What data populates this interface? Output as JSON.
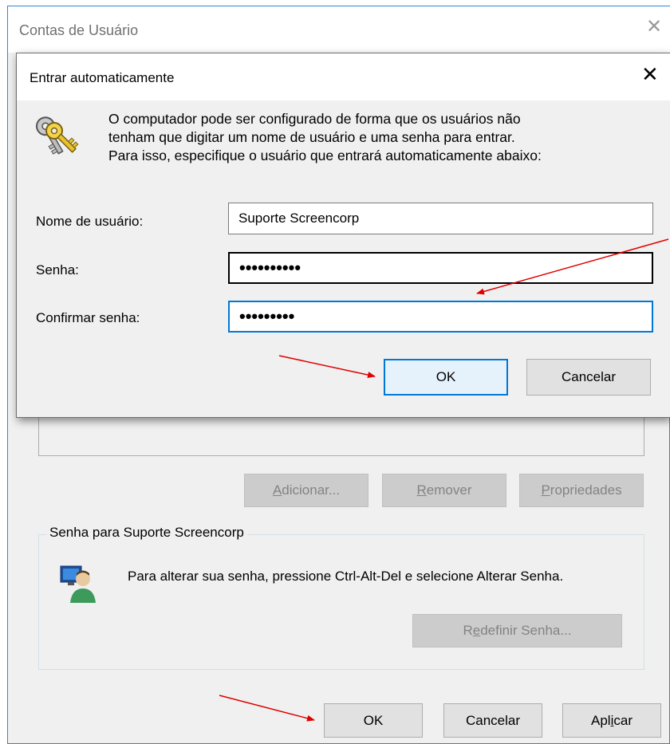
{
  "outer_window": {
    "title": "Contas de Usuário",
    "buttons": {
      "add": {
        "before": "",
        "accel": "A",
        "after": "dicionar..."
      },
      "remove": {
        "before": "",
        "accel": "R",
        "after": "emover"
      },
      "properties": {
        "before": "",
        "accel": "P",
        "after": "ropriedades"
      }
    },
    "password_group": {
      "legend": "Senha para Suporte Screencorp",
      "text": "Para alterar sua senha, pressione Ctrl-Alt-Del e selecione Alterar Senha.",
      "reset_button": {
        "before": "R",
        "accel": "e",
        "after": "definir Senha..."
      }
    },
    "footer_buttons": {
      "ok": "OK",
      "cancel": "Cancelar",
      "apply": {
        "before": "Apl",
        "accel": "i",
        "after": "car"
      }
    }
  },
  "dialog": {
    "title": "Entrar automaticamente",
    "description_lines": [
      "O computador pode ser configurado de forma que os usuários não",
      "tenham que digitar um nome de usuário e uma senha para entrar.",
      "Para isso, especifique o usuário que entrará automaticamente abaixo:"
    ],
    "username_label": "Nome de usuário:",
    "username_value": "Suporte Screencorp",
    "password_label": "Senha:",
    "password_value": "••••••••••",
    "confirm_label": "Confirmar senha:",
    "confirm_value": "•••••••••",
    "ok_label": "OK",
    "cancel_label": "Cancelar"
  },
  "colors": {
    "accent": "#0078d7",
    "annotation_arrow": "#e00000",
    "window_bg": "#f0f0f0"
  },
  "icons": {
    "close": "close-icon",
    "key": "keys-icon",
    "user": "user-monitor-icon"
  }
}
